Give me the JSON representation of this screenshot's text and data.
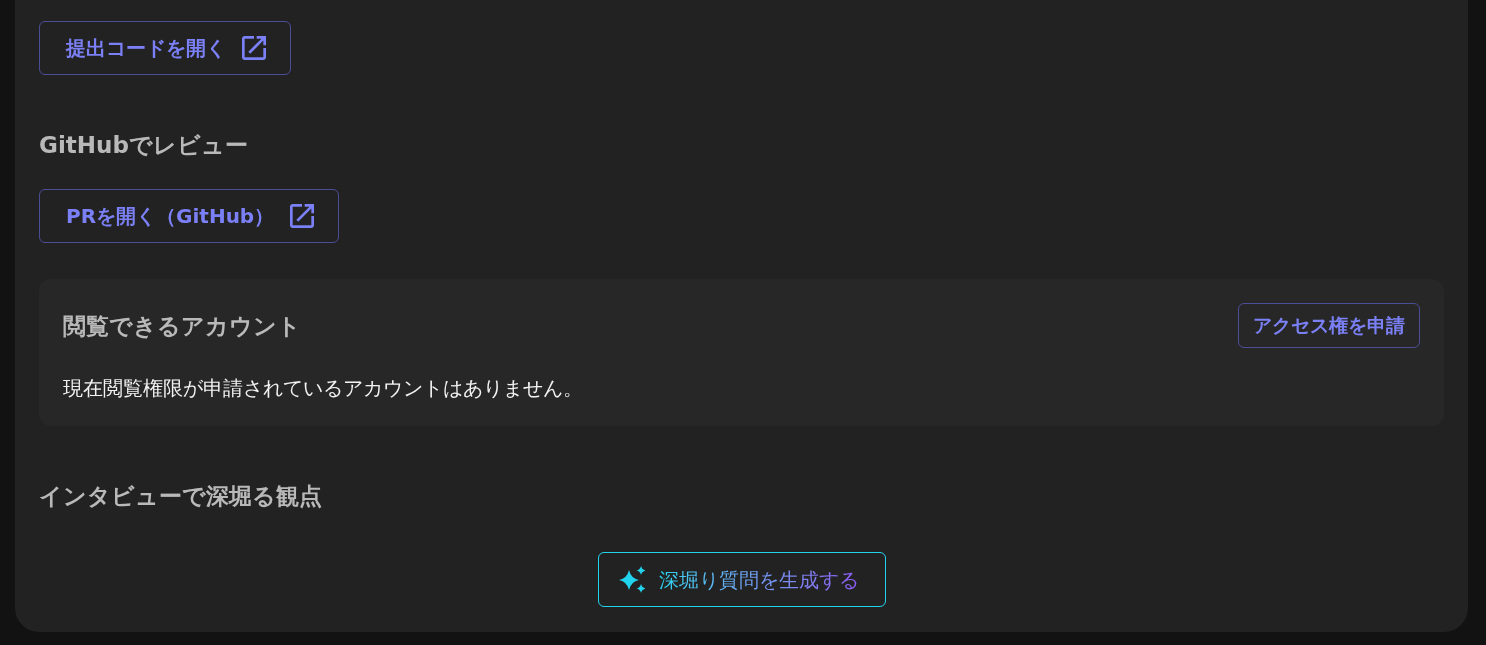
{
  "submission": {
    "open_button": {
      "label": "提出コードを開く"
    }
  },
  "github_review": {
    "heading": "GitHubでレビュー",
    "open_button": {
      "label": "PRを開く（GitHub）"
    }
  },
  "accounts_card": {
    "title": "閲覧できるアカウント",
    "request_button": {
      "label": "アクセス権を申請"
    },
    "message": "現在閲覧権限が申請されているアカウントはありません。"
  },
  "interview": {
    "heading": "インタビューで深堀る観点",
    "generate_button": {
      "label": "深堀り質問を生成する"
    }
  }
}
